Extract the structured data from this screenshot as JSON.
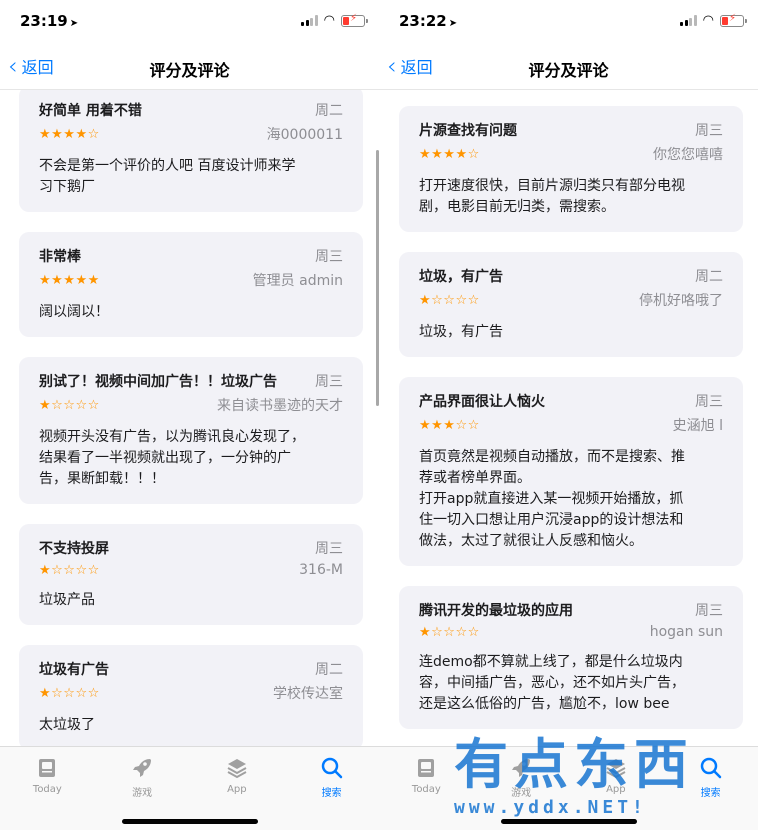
{
  "left": {
    "status": {
      "time": "23:19"
    },
    "nav": {
      "back": "返回",
      "title": "评分及评论"
    },
    "reviews": [
      {
        "title": "好简单 用着不错",
        "date": "周二",
        "stars": "★★★★☆",
        "rating": 4,
        "author": "海0000011",
        "body": "不会是第一个评价的人吧  百度设计师来学\n习下鹅厂"
      },
      {
        "title": "非常棒",
        "date": "周三",
        "stars": "★★★★★",
        "rating": 5,
        "author": "管理员 admin",
        "body": "阔以阔以！"
      },
      {
        "title": "别试了！视频中间加广告！！垃圾广告",
        "date": "周三",
        "stars": "★☆☆☆☆",
        "rating": 1,
        "author": "来自读书墨迹的天才",
        "body": "视频开头没有广告，以为腾讯良心发现了，\n结果看了一半视频就出现了，一分钟的广\n告，果断卸载！！！"
      },
      {
        "title": "不支持投屏",
        "date": "周三",
        "stars": "★☆☆☆☆",
        "rating": 1,
        "author": "316-M",
        "body": "垃圾产品"
      },
      {
        "title": "垃圾有广告",
        "date": "周二",
        "stars": "★☆☆☆☆",
        "rating": 1,
        "author": "学校传达室",
        "body": "太垃圾了"
      }
    ],
    "tabs": [
      {
        "label": "Today",
        "icon": "today-icon"
      },
      {
        "label": "游戏",
        "icon": "rocket-icon"
      },
      {
        "label": "App",
        "icon": "apps-stack-icon"
      },
      {
        "label": "搜索",
        "icon": "search-icon"
      }
    ]
  },
  "right": {
    "status": {
      "time": "23:22"
    },
    "nav": {
      "back": "返回",
      "title": "评分及评论"
    },
    "reviews": [
      {
        "title": "片源查找有问题",
        "date": "周三",
        "stars": "★★★★☆",
        "rating": 4,
        "author": "你您您嘻嘻",
        "body": "打开速度很快，目前片源归类只有部分电视\n剧，电影目前无归类，需搜索。"
      },
      {
        "title": "垃圾，有广告",
        "date": "周二",
        "stars": "★☆☆☆☆",
        "rating": 1,
        "author": "停机好咯哦了",
        "body": "垃圾，有广告"
      },
      {
        "title": "产品界面很让人恼火",
        "date": "周三",
        "stars": "★★★☆☆",
        "rating": 3,
        "author": "史涵旭 l",
        "body": "首页竟然是视频自动播放，而不是搜索、推\n荐或者榜单界面。\n打开app就直接进入某一视频开始播放，抓\n住一切入口想让用户沉浸app的设计想法和\n做法，太过了就很让人反感和恼火。"
      },
      {
        "title": "腾讯开发的最垃圾的应用",
        "date": "周三",
        "stars": "★☆☆☆☆",
        "rating": 1,
        "author": "hogan sun",
        "body": "连demo都不算就上线了，都是什么垃圾内\n容，中间插广告，恶心，还不如片头广告，\n还是这么低俗的广告，尴尬不，low bee"
      }
    ],
    "tabs": [
      {
        "label": "Today",
        "icon": "today-icon"
      },
      {
        "label": "游戏",
        "icon": "rocket-icon"
      },
      {
        "label": "App",
        "icon": "apps-stack-icon"
      },
      {
        "label": "搜索",
        "icon": "search-icon"
      }
    ]
  },
  "watermark": {
    "main": "有点东西",
    "url": "www.yddx.NET!"
  },
  "colors": {
    "accent": "#007aff",
    "star": "#ff9500",
    "card": "#f2f2f7",
    "watermark": "#1976d2"
  }
}
